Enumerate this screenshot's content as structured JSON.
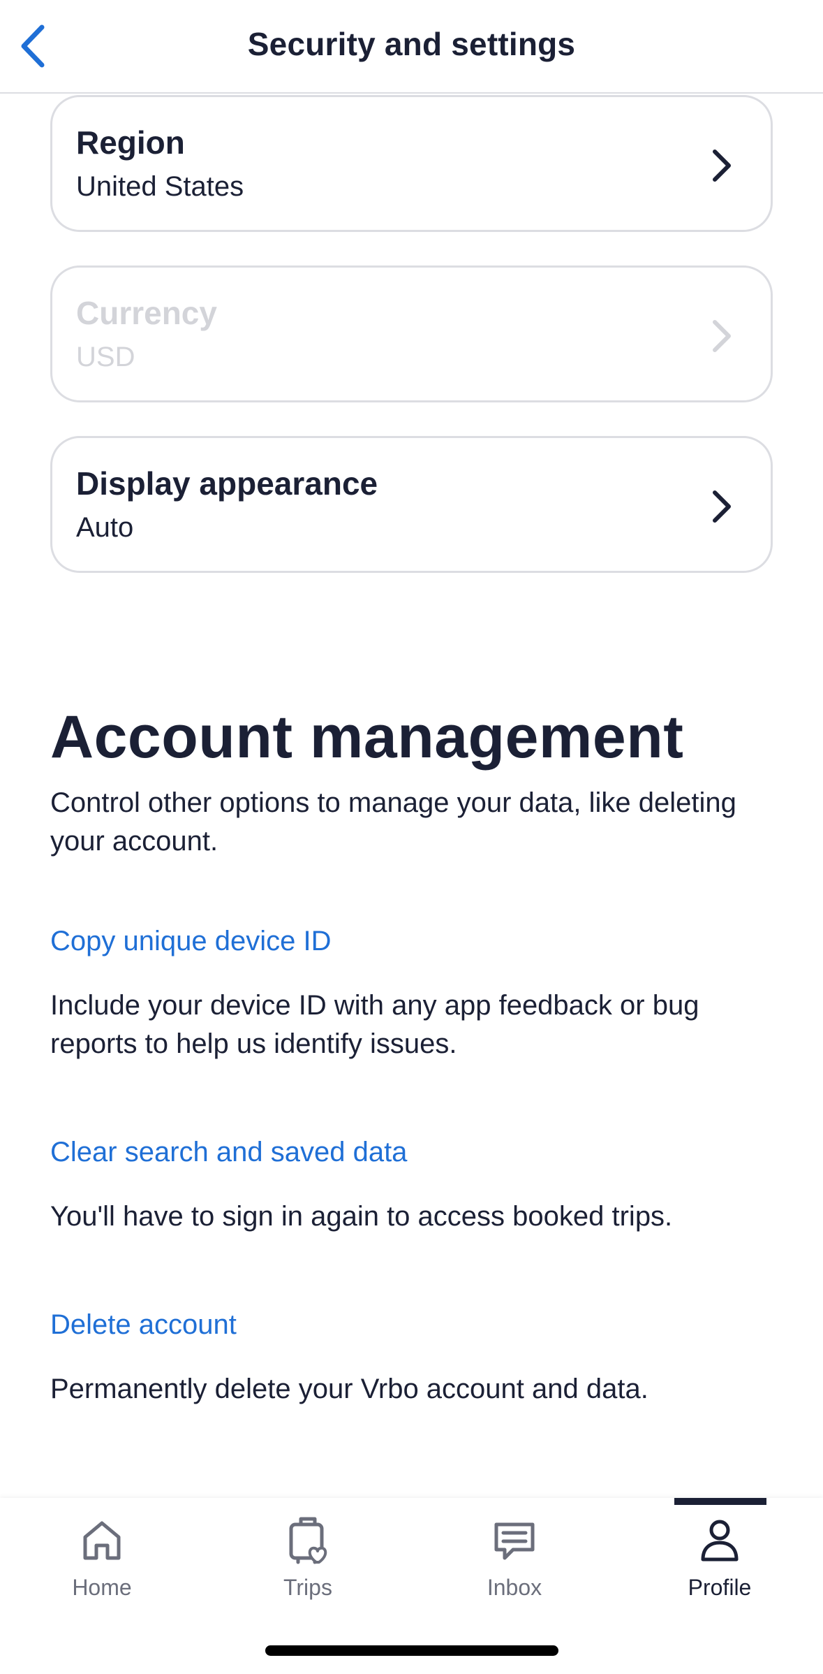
{
  "header": {
    "title": "Security and settings",
    "back_icon": "chevron-left-icon"
  },
  "settings": {
    "cards": [
      {
        "title": "Region",
        "value": "United States",
        "enabled": true
      },
      {
        "title": "Currency",
        "value": "USD",
        "enabled": false
      },
      {
        "title": "Display appearance",
        "value": "Auto",
        "enabled": true
      }
    ]
  },
  "account": {
    "title": "Account management",
    "description": "Control other options to manage your data, like deleting your account.",
    "actions": [
      {
        "label": "Copy unique device ID",
        "description": "Include your device ID with any app feedback or bug reports to help us identify issues."
      },
      {
        "label": "Clear search and saved data",
        "description": "You'll have to sign in again to access booked trips."
      },
      {
        "label": "Delete account",
        "description": "Permanently delete your Vrbo account and data."
      }
    ]
  },
  "tabbar": {
    "tabs": [
      {
        "label": "Home",
        "icon": "home-icon"
      },
      {
        "label": "Trips",
        "icon": "trips-luggage-heart-icon"
      },
      {
        "label": "Inbox",
        "icon": "inbox-message-icon"
      },
      {
        "label": "Profile",
        "icon": "profile-person-icon"
      }
    ],
    "active": "Profile"
  },
  "colors": {
    "text": "#1b2035",
    "link": "#1f6fd6",
    "border": "#dcdde2",
    "disabled": "#d3d4d9",
    "inactive_tab": "#6b6e7b",
    "back_arrow": "#1f6fd6"
  }
}
